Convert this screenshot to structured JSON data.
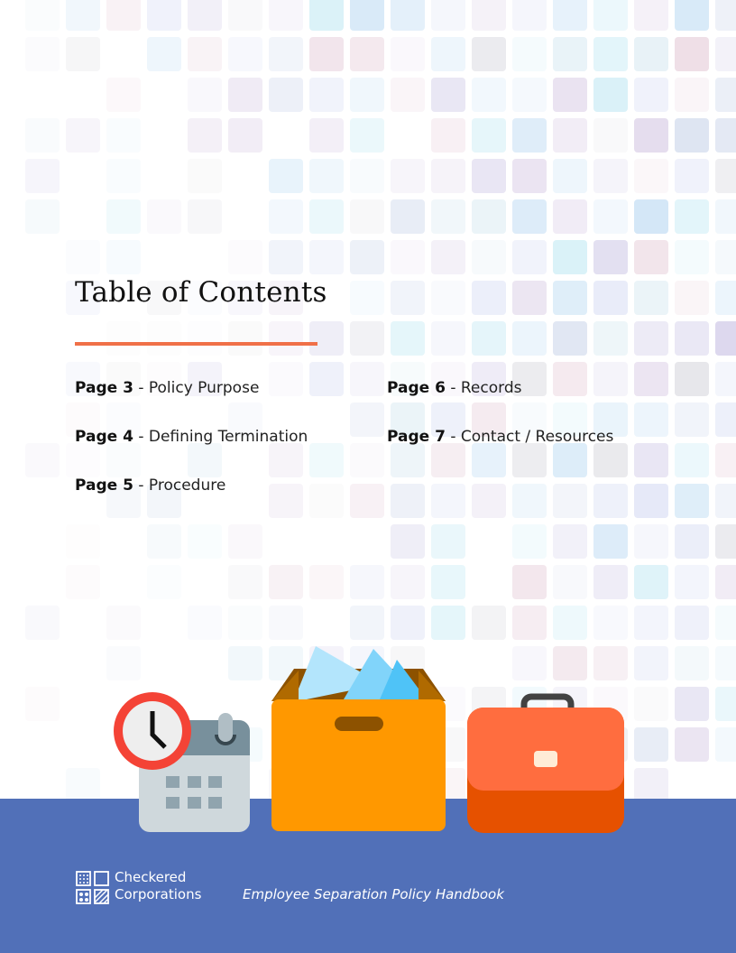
{
  "page": {
    "title": "Table of Contents",
    "accent_color": "#f07048",
    "footer_color": "#5170b8"
  },
  "toc": {
    "items": [
      {
        "page": "Page 3",
        "sep": " - ",
        "label": "Policy Purpose"
      },
      {
        "page": "Page 4",
        "sep": " - ",
        "label": "Defining Termination"
      },
      {
        "page": "Page 5",
        "sep": " - ",
        "label": "Procedure"
      },
      {
        "page": "Page 6",
        "sep": " - ",
        "label": "Records"
      },
      {
        "page": "Page 7",
        "sep": " - ",
        "label": "Contact / Resources"
      }
    ]
  },
  "illustrations": [
    {
      "icon": "clock-calendar-icon"
    },
    {
      "icon": "archive-box-icon"
    },
    {
      "icon": "briefcase-icon"
    }
  ],
  "footer": {
    "company_line1": "Checkered",
    "company_line2": "Corporations",
    "logo_icon": "checkered-logo-icon",
    "document_title": "Employee Separation Policy Handbook"
  }
}
